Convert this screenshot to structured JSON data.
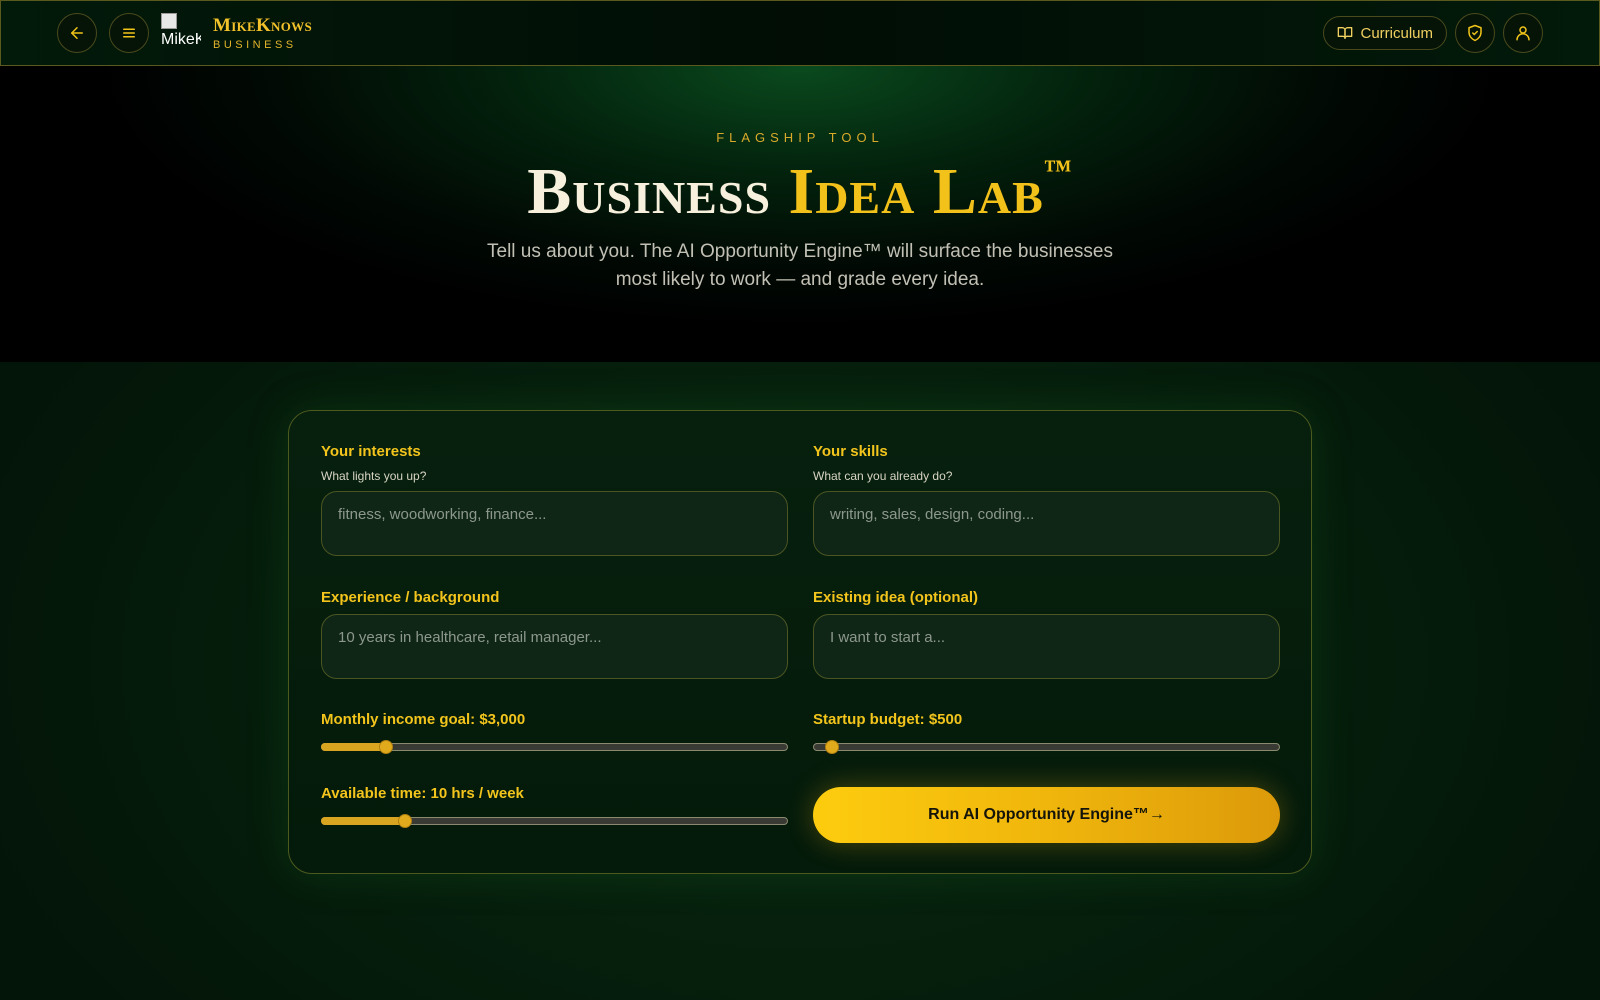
{
  "nav": {
    "back_icon": "arrow-left-icon",
    "menu_icon": "hamburger-menu-icon",
    "logo_alt": "MikeKnows",
    "brand_name": "MikeKnows",
    "brand_sub": "BUSINESS",
    "curriculum_label": "Curriculum",
    "curriculum_icon": "open-book-icon",
    "shield_icon": "shield-check-icon",
    "profile_icon": "user-icon"
  },
  "hero": {
    "eyebrow": "FLAGSHIP TOOL",
    "title_part1": "Business ",
    "title_accent": "Idea Lab",
    "title_mark": "™",
    "subtitle": "Tell us about you. The AI Opportunity Engine™ will surface the businesses most likely to work — and grade every idea."
  },
  "form": {
    "interests": {
      "label": "Your interests",
      "help": "What lights you up?",
      "placeholder": "fitness, woodworking, finance...",
      "value": ""
    },
    "skills": {
      "label": "Your skills",
      "help": "What can you already do?",
      "placeholder": "writing, sales, design, coding...",
      "value": ""
    },
    "experience": {
      "label": "Experience / background",
      "placeholder": "10 years in healthcare, retail manager...",
      "value": ""
    },
    "existing_idea": {
      "label": "Existing idea (optional)",
      "placeholder": "I want to start a...",
      "value": ""
    },
    "income_goal": {
      "label": "Monthly income goal: $3,000",
      "fraction": 0.14
    },
    "startup_budget": {
      "label": "Startup budget: $500",
      "fraction": 0.04
    },
    "available_time": {
      "label": "Available time: 10 hrs / week",
      "fraction": 0.18
    },
    "run_button_label": "Run AI Opportunity Engine™→"
  },
  "colors": {
    "accent_gold": "#f2c41c",
    "background_dark_green": "#031206",
    "button_gradient_start": "#fdcc0e",
    "button_gradient_end": "#dc9a0a"
  }
}
